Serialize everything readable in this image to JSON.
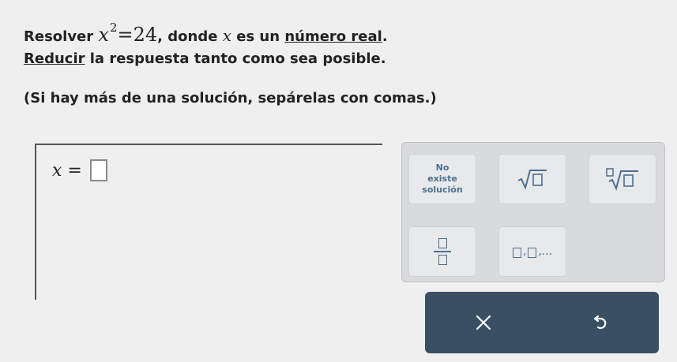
{
  "question": {
    "line1_prefix": "Resolver ",
    "equation_base": "x",
    "equation_exp": "2",
    "equation_rhs": "=24",
    "line1_mid": ", donde ",
    "var": "x",
    "line1_mid2": " es un ",
    "line1_link": "número real",
    "line1_end": ".",
    "line2_link": "Reducir",
    "line2_rest": " la respuesta tanto como sea posible.",
    "line3": "(Si hay más de una solución, sepárelas con comas.)"
  },
  "answer": {
    "label": "x =",
    "value": ""
  },
  "keypad": {
    "no_solution_line1": "No",
    "no_solution_line2": "existe",
    "no_solution_line3": "solución",
    "list_suffix": ",..."
  },
  "icons": {
    "sqrt": "sqrt-icon",
    "nth_root": "nth-root-icon",
    "fraction": "fraction-icon",
    "list": "list-icon",
    "clear": "x-icon",
    "undo": "undo-icon"
  },
  "colors": {
    "keypad_glyph": "#4c6f91",
    "action_bar": "#3a4f63"
  }
}
